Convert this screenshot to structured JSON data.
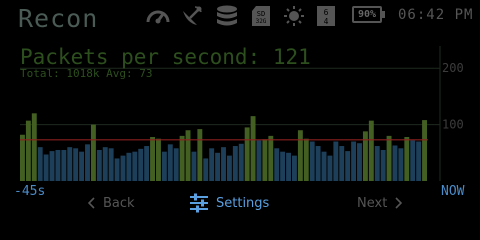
{
  "header": {
    "title": "Recon",
    "icons": [
      "gauge-icon",
      "satellite-dish-icon",
      "database-icon",
      "sd-card-icon",
      "brightness-icon",
      "network-64-icon"
    ],
    "battery": "90%",
    "clock": "06:42 PM"
  },
  "stats": {
    "headline": "Packets per second: 121",
    "subline": "Total: 1018k  Avg: 73"
  },
  "chart_data": {
    "type": "bar",
    "ylim": [
      0,
      250
    ],
    "y_ticks": [
      {
        "value": 200,
        "label": "200"
      },
      {
        "value": 100,
        "label": "100"
      }
    ],
    "average": 73,
    "values": [
      82,
      107,
      120,
      60,
      47,
      53,
      55,
      55,
      60,
      58,
      52,
      65,
      100,
      55,
      60,
      58,
      40,
      45,
      50,
      52,
      57,
      62,
      78,
      75,
      52,
      65,
      58,
      80,
      90,
      52,
      92,
      40,
      58,
      50,
      60,
      45,
      62,
      66,
      95,
      115,
      72,
      74,
      80,
      58,
      52,
      50,
      45,
      90,
      75,
      70,
      62,
      52,
      45,
      70,
      62,
      53,
      70,
      67,
      88,
      107,
      62,
      55,
      80,
      63,
      58,
      78,
      72,
      70,
      108
    ],
    "colors": {
      "high": "#445f22",
      "low": "#1d3f59",
      "avg_line": "#8b1f1f",
      "grid": "#1e2a1e",
      "tick_label": "#3c3c3c"
    }
  },
  "axis": {
    "x_min": "-45s",
    "x_max": "NOW"
  },
  "nav": {
    "back": "Back",
    "settings": "Settings",
    "next": "Next"
  }
}
